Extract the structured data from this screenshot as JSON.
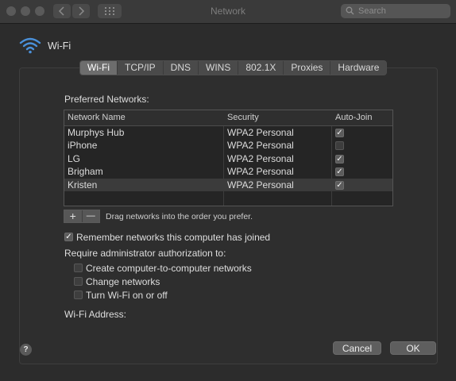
{
  "window": {
    "title": "Network",
    "search_placeholder": "Search"
  },
  "icons": {
    "back": "chevron-left-icon",
    "forward": "chevron-right-icon",
    "grid": "grid-icon",
    "wifi": "wifi-icon",
    "search": "search-icon",
    "help": "help-icon"
  },
  "wifi": {
    "title": "Wi-Fi"
  },
  "tabs": [
    {
      "label": "Wi-Fi",
      "active": true
    },
    {
      "label": "TCP/IP",
      "active": false
    },
    {
      "label": "DNS",
      "active": false
    },
    {
      "label": "WINS",
      "active": false
    },
    {
      "label": "802.1X",
      "active": false
    },
    {
      "label": "Proxies",
      "active": false
    },
    {
      "label": "Hardware",
      "active": false
    }
  ],
  "preferred": {
    "label": "Preferred Networks:",
    "columns": {
      "name": "Network Name",
      "security": "Security",
      "autojoin": "Auto-Join"
    },
    "rows": [
      {
        "name": "Murphys Hub",
        "security": "WPA2 Personal",
        "autojoin": true,
        "selected": false
      },
      {
        "name": "iPhone",
        "security": "WPA2 Personal",
        "autojoin": false,
        "selected": false
      },
      {
        "name": "LG",
        "security": "WPA2 Personal",
        "autojoin": true,
        "selected": false
      },
      {
        "name": "Brigham",
        "security": "WPA2 Personal",
        "autojoin": true,
        "selected": false
      },
      {
        "name": "Kristen",
        "security": "WPA2 Personal",
        "autojoin": true,
        "selected": true
      }
    ],
    "add_label": "+",
    "remove_label": "—",
    "drag_hint": "Drag networks into the order you prefer."
  },
  "options": {
    "remember": {
      "label": "Remember networks this computer has joined",
      "checked": true
    },
    "admin_heading": "Require administrator authorization to:",
    "admin_items": [
      {
        "label": "Create computer-to-computer networks",
        "checked": false
      },
      {
        "label": "Change networks",
        "checked": false
      },
      {
        "label": "Turn Wi-Fi on or off",
        "checked": false
      }
    ]
  },
  "address": {
    "label": "Wi-Fi Address:"
  },
  "footer": {
    "help_label": "?",
    "cancel_label": "Cancel",
    "ok_label": "OK"
  }
}
